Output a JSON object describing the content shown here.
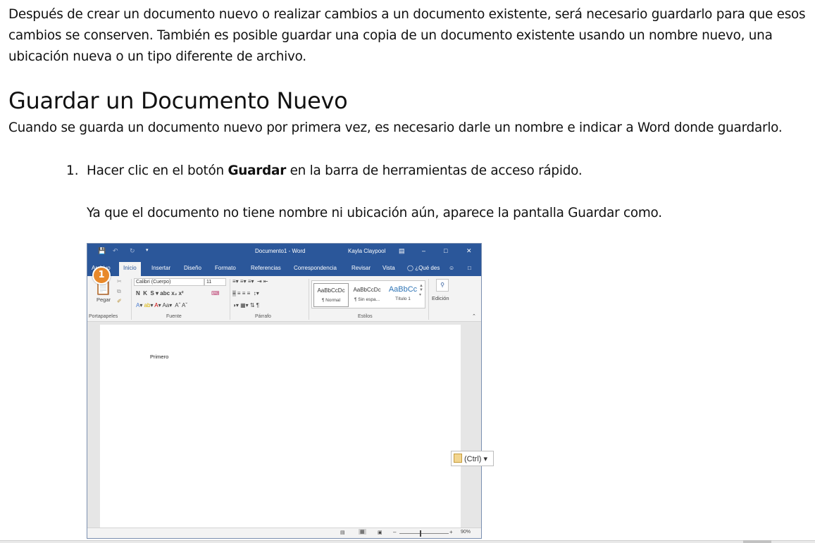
{
  "intro": "Después de crear un documento nuevo o realizar cambios a un documento existente, será necesario guardarlo para que esos cambios se conserven. También es posible guardar una copia de un documento existente usando un nombre nuevo, una ubicación nueva o un tipo diferente de archivo.",
  "heading": "Guardar un Documento Nuevo",
  "subtext": "Cuando se guarda un documento nuevo por primera vez, es necesario darle un nombre e indicar a Word donde guardarlo.",
  "step": {
    "number": "1.",
    "before": "Hacer clic en el botón ",
    "bold": "Guardar",
    "after": " en la barra de herramientas de acceso rápido.",
    "followup": "Ya que el documento no tiene nombre ni ubicación aún, aparece la pantalla Guardar como."
  },
  "word": {
    "title": "Documento1 - Word",
    "user": "Kayla Claypool",
    "badge": "1",
    "tabs": [
      "Archivo",
      "Inicio",
      "Insertar",
      "Diseño",
      "Formato",
      "Referencias",
      "Correspondencia",
      "Revisar",
      "Vista",
      "¿Qué des"
    ],
    "active_tab": "Inicio",
    "font_name": "Calibri (Cuerpo)",
    "font_size": "11",
    "paste_label": "Pegar",
    "groups": [
      "Portapapeles",
      "Fuente",
      "Párrafo",
      "Estilos",
      "Edición"
    ],
    "styles": [
      {
        "sample": "AaBbCcDc",
        "label": "¶ Normal"
      },
      {
        "sample": "AaBbCcDc",
        "label": "¶ Sin espa..."
      },
      {
        "sample": "AaBbCc",
        "label": "Título 1"
      }
    ],
    "doc_text": "Primero",
    "zoom": "90%",
    "colors": {
      "title_bar": "#2b579a",
      "badge": "#e8892b"
    }
  },
  "paste_tag": "(Ctrl)"
}
